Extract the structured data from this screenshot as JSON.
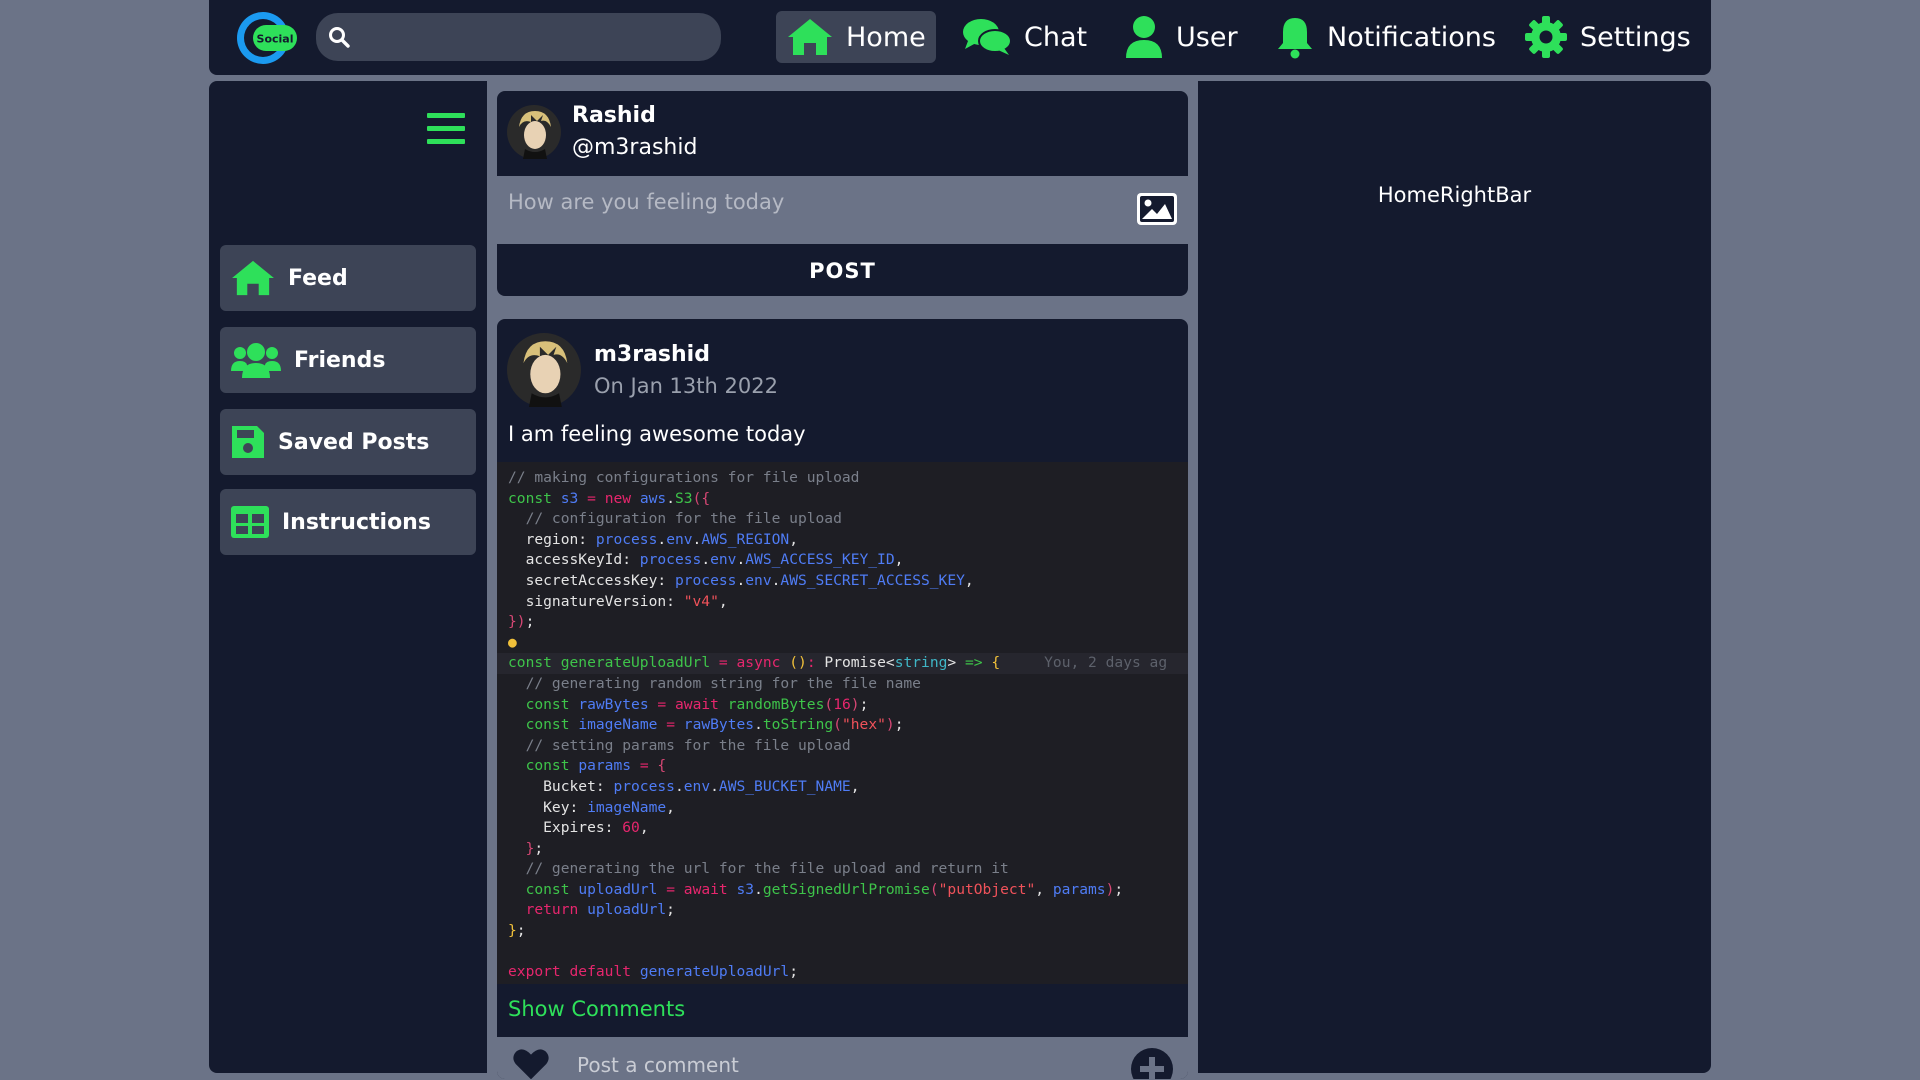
{
  "colors": {
    "accent": "#2ee05a",
    "panel": "#141a2e",
    "page_bg": "#6b7387",
    "button_bg": "#3d4456"
  },
  "topbar": {
    "logo_text": "Social",
    "search_placeholder": "",
    "nav": [
      {
        "label": "Home",
        "icon": "home-icon",
        "active": true
      },
      {
        "label": "Chat",
        "icon": "chat-icon",
        "active": false
      },
      {
        "label": "User",
        "icon": "user-icon",
        "active": false
      },
      {
        "label": "Notifications",
        "icon": "bell-icon",
        "active": false
      },
      {
        "label": "Settings",
        "icon": "gear-icon",
        "active": false
      }
    ]
  },
  "sidebar": {
    "menu_icon": "hamburger-icon",
    "items": [
      {
        "label": "Feed",
        "icon": "home-icon"
      },
      {
        "label": "Friends",
        "icon": "users-icon"
      },
      {
        "label": "Saved Posts",
        "icon": "save-icon"
      },
      {
        "label": "Instructions",
        "icon": "table-icon"
      }
    ]
  },
  "composer": {
    "name": "Rashid",
    "handle": "@m3rashid",
    "placeholder": "How are you feeling today",
    "post_label": "POST"
  },
  "post": {
    "author": "m3rashid",
    "date": "On Jan 13th 2022",
    "text": "I am feeling awesome today",
    "show_comments_label": "Show Comments",
    "comment_placeholder": "Post a comment",
    "code_lines": [
      "// making configurations for file upload",
      "const s3 = new aws.S3({",
      "  // configuration for the file upload",
      "  region: process.env.AWS_REGION,",
      "  accessKeyId: process.env.AWS_ACCESS_KEY_ID,",
      "  secretAccessKey: process.env.AWS_SECRET_ACCESS_KEY,",
      "  signatureVersion: \"v4\",",
      "});",
      "",
      "const generateUploadUrl = async (): Promise<string> => {",
      "  // generating random string for the file name",
      "  const rawBytes = await randomBytes(16);",
      "  const imageName = rawBytes.toString(\"hex\");",
      "  // setting params for the file upload",
      "  const params = {",
      "    Bucket: process.env.AWS_BUCKET_NAME,",
      "    Key: imageName,",
      "    Expires: 60,",
      "  };",
      "  // generating the url for the file upload and return it",
      "  const uploadUrl = await s3.getSignedUrlPromise(\"putObject\", params);",
      "  return uploadUrl;",
      "};",
      "",
      "export default generateUploadUrl;"
    ],
    "blame_text": "You, 2 days ag"
  },
  "rightbar": {
    "label": "HomeRightBar"
  }
}
